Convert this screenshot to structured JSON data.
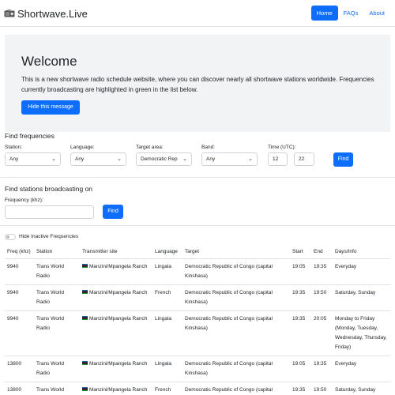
{
  "navbar": {
    "brand": "Shortwave.Live",
    "links": [
      {
        "label": "Home",
        "active": true
      },
      {
        "label": "FAQs",
        "active": false
      },
      {
        "label": "About",
        "active": false
      }
    ]
  },
  "hero": {
    "title": "Welcome",
    "text": "This is a new shortwave radio schedule website, where you can discover nearly all shortwave stations worldwide. Frequencies currently broadcasting are highlighted in green in the list below.",
    "button": "Hide this message"
  },
  "find_frequencies": {
    "title": "Find frequencies",
    "station": {
      "label": "Station:",
      "value": "Any"
    },
    "language": {
      "label": "Language:",
      "value": "Any"
    },
    "target": {
      "label": "Target area:",
      "value": "Democratic Rep"
    },
    "band": {
      "label": "Band:",
      "value": "Any"
    },
    "time": {
      "label": "Time (UTC):",
      "hour": "12",
      "minute": "22"
    },
    "button": "Find"
  },
  "find_stations": {
    "title": "Find stations broadcasting on",
    "freq_label": "Frequency (khz):",
    "freq_value": "",
    "button": "Find"
  },
  "toggle": {
    "label": "Hide Inactive Frequencies"
  },
  "table": {
    "headers": {
      "freq": "Freq (khz)",
      "station": "Station",
      "site": "Transmitter site",
      "language": "Language",
      "target": "Target",
      "start": "Start",
      "end": "End",
      "days": "Days/Info"
    },
    "rows": [
      {
        "freq": "9940",
        "station": "Trans World Radio",
        "site": "Manzini/Mpangela Ranch",
        "language": "Lingala",
        "target": "Democratic Republic of Congo (capital Kinshasa)",
        "start": "19:05",
        "end": "19:35",
        "days": "Everyday"
      },
      {
        "freq": "9940",
        "station": "Trans World Radio",
        "site": "Manzini/Mpangela Ranch",
        "language": "French",
        "target": "Democratic Republic of Congo (capital Kinshasa)",
        "start": "19:35",
        "end": "19:50",
        "days": "Saturday, Sunday"
      },
      {
        "freq": "9940",
        "station": "Trans World Radio",
        "site": "Manzini/Mpangela Ranch",
        "language": "Lingala",
        "target": "Democratic Republic of Congo (capital Kinshasa)",
        "start": "19:35",
        "end": "20:05",
        "days": "Monday to Friday (Monday, Tuesday, Wednesday, Thursday, Friday)"
      },
      {
        "freq": "13800",
        "station": "Trans World Radio",
        "site": "Manzini/Mpangela Ranch",
        "language": "Lingala",
        "target": "Democratic Republic of Congo (capital Kinshasa)",
        "start": "19:05",
        "end": "19:35",
        "days": "Everyday"
      },
      {
        "freq": "13800",
        "station": "Trans World Radio",
        "site": "Manzini/Mpangela Ranch",
        "language": "French",
        "target": "Democratic Republic of Congo (capital Kinshasa)",
        "start": "19:35",
        "end": "19:50",
        "days": "Saturday, Sunday"
      }
    ]
  }
}
